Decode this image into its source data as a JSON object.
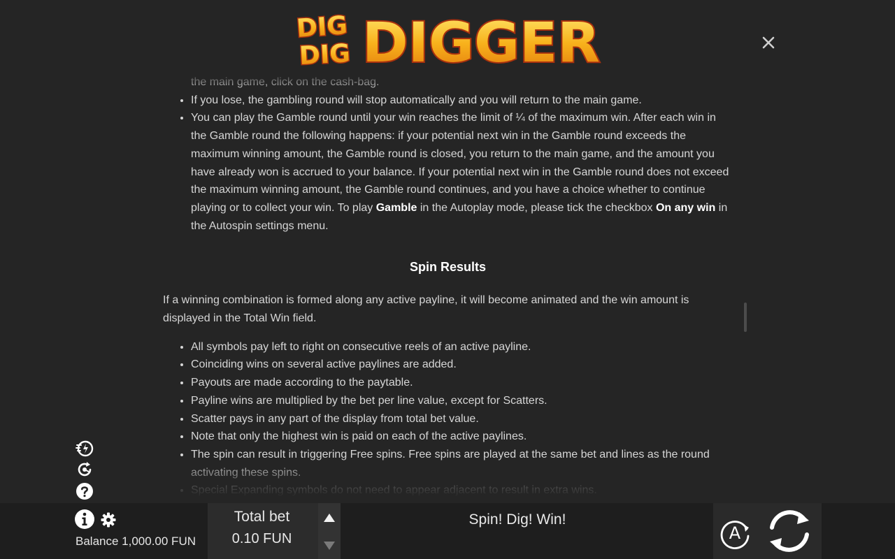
{
  "game": {
    "logo_small_top": "DIG",
    "logo_small_bottom": "DIG",
    "logo_big": "DIGGER"
  },
  "help": {
    "gamble_items": [
      "the main game, click on the cash-bag.",
      "If you lose, the gambling round will stop automatically and you will return to the main game."
    ],
    "gamble_limit": {
      "part1": "You can play the Gamble round until your win reaches the limit of ¼ of the maximum win. After each win in the Gamble round the following happens: if your potential next win in the Gamble round exceeds the maximum winning amount, the Gamble round is closed, you return to the main game, and the amount you have already won is accrued to your balance. If your potential next win in the Gamble round does not exceed the maximum winning amount, the Gamble round continues, and you have a choice whether to continue playing or to collect your win. To play ",
      "bold1": "Gamble",
      "part2": " in the Autoplay mode, please tick the checkbox ",
      "bold2": "On any win",
      "part3": " in the Autospin settings menu."
    },
    "section_title": "Spin Results",
    "intro": "If a winning combination is formed along any active payline, it will become animated and the win amount is displayed in the Total Win field.",
    "rules": [
      "All symbols pay left to right on consecutive reels of an active payline.",
      "Coinciding wins on several active paylines are added.",
      "Payouts are made according to the paytable.",
      "Payline wins are multiplied by the bet per line value, except for Scatters.",
      "Scatter pays in any part of the display from total bet value.",
      "Note that only the highest win is paid on each of the active paylines.",
      "The spin can result in triggering Free spins. Free spins are played at the same bet and lines as the round activating these spins.",
      "Special Expanding symbols do not need to appear adjacent to result in extra wins."
    ]
  },
  "bottom_bar": {
    "balance": "Balance 1,000.00 FUN",
    "total_bet_label": "Total bet",
    "total_bet_value": "0.10 FUN",
    "tagline": "Spin! Dig! Win!",
    "autoplay_letter": "A"
  },
  "side_icons": {
    "top": "turbo-icon",
    "middle": "quick-spin-icon",
    "bottom": "help-question-icon"
  },
  "colors": {
    "background": "#252525",
    "bar": "#1e1e1e",
    "logo_fill": "#f6b21c",
    "logo_outline": "#a8310e"
  }
}
